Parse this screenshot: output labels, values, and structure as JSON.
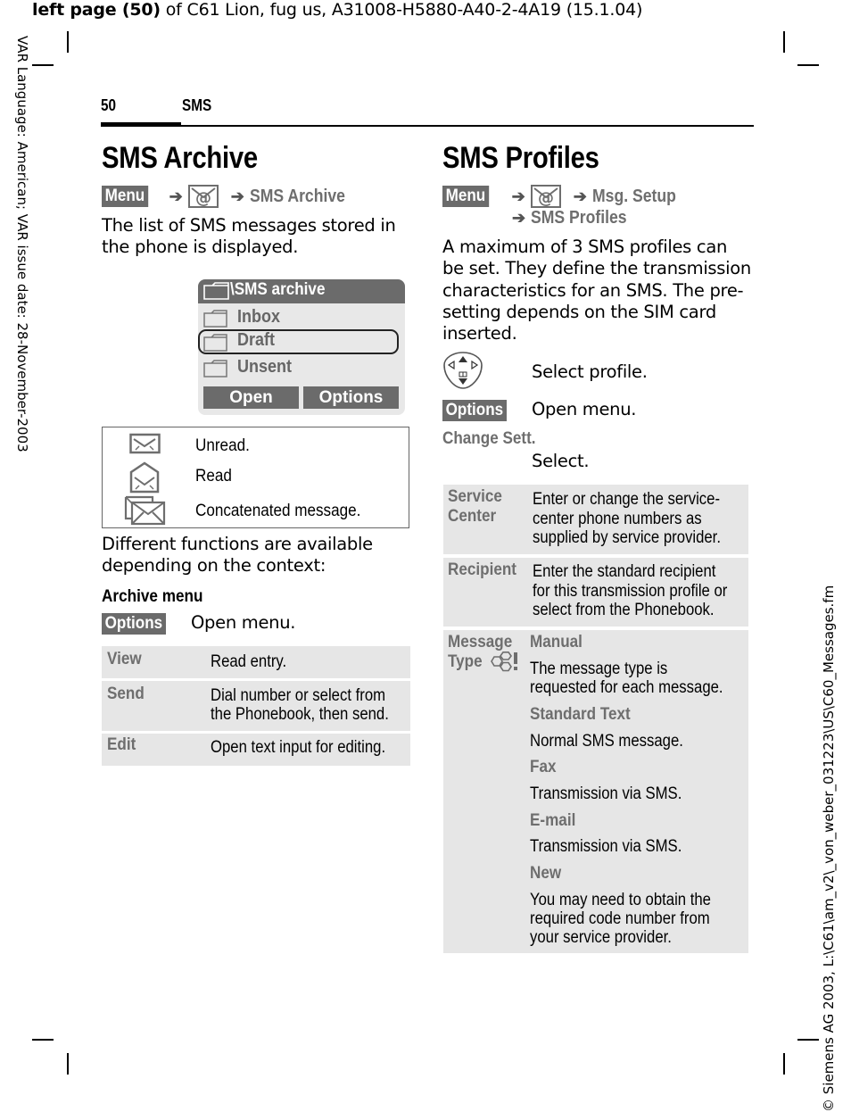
{
  "print_header": {
    "bold_part": "left page (50)",
    "rest": " of C61 Lion, fug us, A31008-H5880-A40-2-4A19 (15.1.04)"
  },
  "side_left": "VAR Language: American; VAR issue date: 28-November-2003",
  "side_right": "© Siemens AG 2003, L:\\C61\\am_v2\\_von_weber_031223\\US\\C60_Messages.fm",
  "page": {
    "number": "50",
    "section": "SMS"
  },
  "archive": {
    "title": "SMS Archive",
    "path": {
      "menu_key": "Menu",
      "icon": "messages-icon",
      "step": "SMS Archive"
    },
    "intro": [
      "The list of SMS messages stored in",
      "the phone is displayed."
    ],
    "phone_screen": {
      "title": "\\SMS archive",
      "folders": [
        {
          "label": "Inbox",
          "selected": false
        },
        {
          "label": "Draft",
          "selected": true
        },
        {
          "label": "Unsent",
          "selected": false
        }
      ],
      "softkeys": [
        "Open",
        "Options"
      ]
    },
    "icon_legend": [
      {
        "icon": "unread-envelope-icon",
        "label": "Unread."
      },
      {
        "icon": "read-envelope-icon",
        "label": "Read"
      },
      {
        "icon": "concatenated-envelope-icon",
        "label": "Concatenated message."
      }
    ],
    "context_text": [
      "Different functions are available",
      "depending on the context:"
    ],
    "menu_heading": "Archive menu",
    "options_key": "Options",
    "options_desc": "Open menu.",
    "functions": [
      {
        "key": "View",
        "desc": [
          "Read entry."
        ]
      },
      {
        "key": "Send",
        "desc": [
          "Dial number or select from",
          "the Phonebook, then send."
        ]
      },
      {
        "key": "Edit",
        "desc": [
          "Open text input for editing."
        ]
      }
    ]
  },
  "profiles": {
    "title": "SMS Profiles",
    "path": {
      "menu_key": "Menu",
      "icon": "messages-icon",
      "step1": "Msg. Setup",
      "step2": "SMS Profiles"
    },
    "intro": [
      "A maximum of 3 SMS profiles can",
      "be set. They define the transmission",
      "characteristics for an SMS. The pre-",
      "setting depends on the SIM card",
      "inserted."
    ],
    "nav_desc": "Select profile.",
    "options_key": "Options",
    "options_desc": "Open menu.",
    "change_label": "Change Sett.",
    "change_desc": "Select.",
    "settings": [
      {
        "key": [
          "Service",
          "Center"
        ],
        "desc": [
          "Enter or change the service-",
          "center phone numbers as",
          "supplied by service provider."
        ]
      },
      {
        "key": [
          "Recipient"
        ],
        "desc": [
          "Enter the standard recipient",
          "for this transmission profile or",
          "select from the Phonebook."
        ]
      }
    ],
    "message_type": {
      "key": [
        "Message",
        "Type"
      ],
      "options": [
        {
          "name": "Manual",
          "desc": [
            "The message type is",
            "requested for each message."
          ]
        },
        {
          "name": "Standard Text",
          "desc": [
            "Normal SMS message."
          ]
        },
        {
          "name": "Fax",
          "desc": [
            "Transmission via SMS."
          ]
        },
        {
          "name": "E-mail",
          "desc": [
            "Transmission via SMS."
          ]
        },
        {
          "name": "New",
          "desc": [
            "You may need to obtain the",
            "required code number from",
            "your service provider."
          ]
        }
      ]
    }
  }
}
